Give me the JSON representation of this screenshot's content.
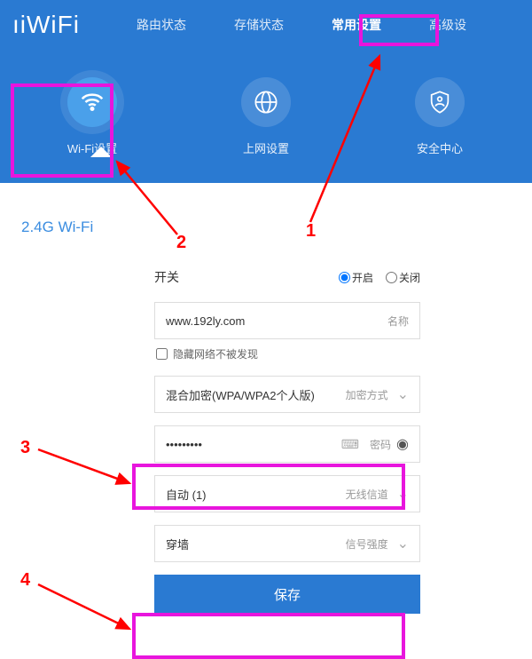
{
  "logo": "ıiWiFi",
  "nav": {
    "items": [
      "路由状态",
      "存储状态",
      "常用设置",
      "高级设"
    ],
    "activeIndex": 2
  },
  "subnav": {
    "items": [
      {
        "label": "Wi-Fi设置",
        "icon": "wifi"
      },
      {
        "label": "上网设置",
        "icon": "globe"
      },
      {
        "label": "安全中心",
        "icon": "shield"
      }
    ],
    "activeIndex": 0
  },
  "section": {
    "title": "2.4G Wi-Fi"
  },
  "form": {
    "switch": {
      "label": "开关",
      "options": [
        "开启",
        "关闭"
      ],
      "selected": "开启"
    },
    "name": {
      "value": "www.192ly.com",
      "label": "名称"
    },
    "hide": {
      "label": "隐藏网络不被发现",
      "checked": false
    },
    "encryption": {
      "value": "混合加密(WPA/WPA2个人版)",
      "label": "加密方式"
    },
    "password": {
      "value": "•••••••••",
      "label": "密码"
    },
    "channel": {
      "value": "自动 (1)",
      "label": "无线信道"
    },
    "strength": {
      "value": "穿墙",
      "label": "信号强度"
    },
    "save": "保存"
  },
  "annotations": {
    "n1": "1",
    "n2": "2",
    "n3": "3",
    "n4": "4"
  }
}
